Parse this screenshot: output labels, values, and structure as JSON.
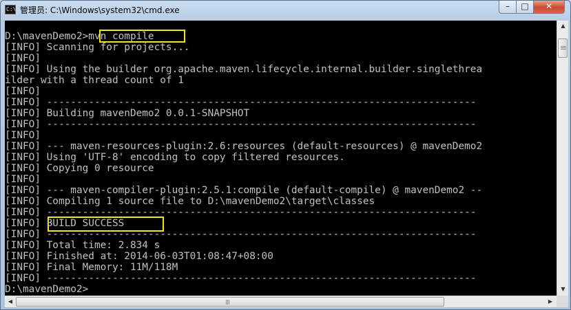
{
  "window": {
    "title": "管理员: C:\\Windows\\system32\\cmd.exe",
    "icon_label": "C:\\",
    "controls": {
      "minimize": "–",
      "maximize": "□",
      "close": "✕"
    }
  },
  "console": {
    "lines": [
      "D:\\mavenDemo2>mvn compile",
      "[INFO] Scanning for projects...",
      "[INFO]",
      "[INFO] Using the builder org.apache.maven.lifecycle.internal.builder.singlethrea",
      "ilder with a thread count of 1",
      "[INFO]",
      "[INFO] ------------------------------------------------------------------------",
      "[INFO] Building mavenDemo2 0.0.1-SNAPSHOT",
      "[INFO] ------------------------------------------------------------------------",
      "[INFO]",
      "[INFO] --- maven-resources-plugin:2.6:resources (default-resources) @ mavenDemo2",
      "[INFO] Using 'UTF-8' encoding to copy filtered resources.",
      "[INFO] Copying 0 resource",
      "[INFO]",
      "[INFO] --- maven-compiler-plugin:2.5.1:compile (default-compile) @ mavenDemo2 --",
      "[INFO] Compiling 1 source file to D:\\mavenDemo2\\target\\classes",
      "[INFO] ------------------------------------------------------------------------",
      "[INFO] BUILD SUCCESS",
      "[INFO] ------------------------------------------------------------------------",
      "[INFO] Total time: 2.834 s",
      "[INFO] Finished at: 2014-06-03T01:08:47+08:00",
      "[INFO] Final Memory: 11M/118M",
      "[INFO] ------------------------------------------------------------------------",
      "D:\\mavenDemo2>"
    ],
    "highlights": [
      "mvn compile",
      "BUILD SUCCESS"
    ],
    "colors": {
      "background": "#000000",
      "text": "#c0c0c0",
      "highlight_border": "#f3e81f"
    }
  },
  "scrollbars": {
    "up_arrow": "▲",
    "down_arrow": "▼",
    "left_arrow": "◀",
    "right_arrow": "▶"
  }
}
